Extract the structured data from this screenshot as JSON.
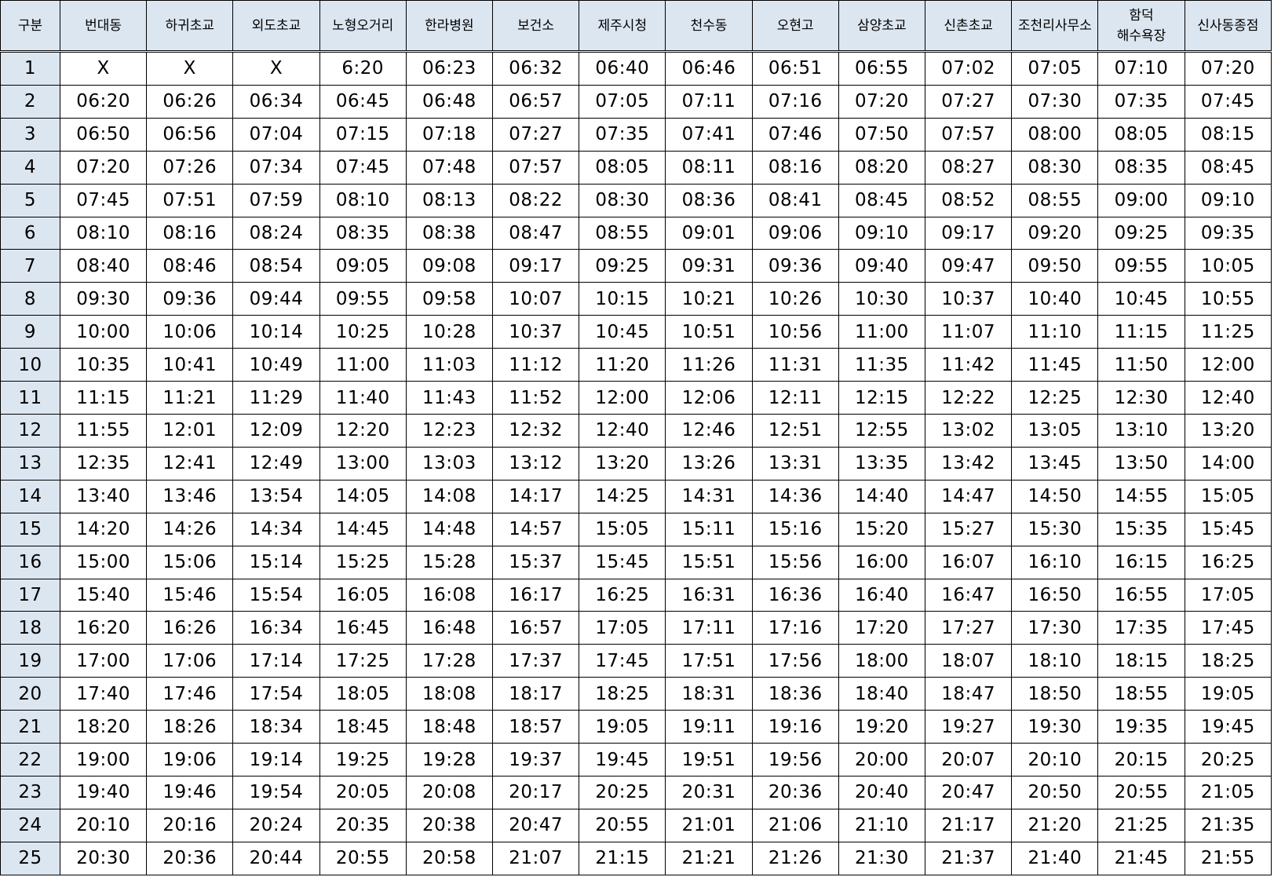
{
  "table": {
    "columns": [
      "구분",
      "번대동",
      "하귀초교",
      "외도초교",
      "노형오거리",
      "한라병원",
      "보건소",
      "제주시청",
      "천수동",
      "오현고",
      "삼양초교",
      "신촌초교",
      "조천리사무소",
      "함덕 해수욕장",
      "신사동종점"
    ],
    "rows": [
      [
        "1",
        "X",
        "X",
        "X",
        "6:20",
        "06:23",
        "06:32",
        "06:40",
        "06:46",
        "06:51",
        "06:55",
        "07:02",
        "07:05",
        "07:10",
        "07:20"
      ],
      [
        "2",
        "06:20",
        "06:26",
        "06:34",
        "06:45",
        "06:48",
        "06:57",
        "07:05",
        "07:11",
        "07:16",
        "07:20",
        "07:27",
        "07:30",
        "07:35",
        "07:45"
      ],
      [
        "3",
        "06:50",
        "06:56",
        "07:04",
        "07:15",
        "07:18",
        "07:27",
        "07:35",
        "07:41",
        "07:46",
        "07:50",
        "07:57",
        "08:00",
        "08:05",
        "08:15"
      ],
      [
        "4",
        "07:20",
        "07:26",
        "07:34",
        "07:45",
        "07:48",
        "07:57",
        "08:05",
        "08:11",
        "08:16",
        "08:20",
        "08:27",
        "08:30",
        "08:35",
        "08:45"
      ],
      [
        "5",
        "07:45",
        "07:51",
        "07:59",
        "08:10",
        "08:13",
        "08:22",
        "08:30",
        "08:36",
        "08:41",
        "08:45",
        "08:52",
        "08:55",
        "09:00",
        "09:10"
      ],
      [
        "6",
        "08:10",
        "08:16",
        "08:24",
        "08:35",
        "08:38",
        "08:47",
        "08:55",
        "09:01",
        "09:06",
        "09:10",
        "09:17",
        "09:20",
        "09:25",
        "09:35"
      ],
      [
        "7",
        "08:40",
        "08:46",
        "08:54",
        "09:05",
        "09:08",
        "09:17",
        "09:25",
        "09:31",
        "09:36",
        "09:40",
        "09:47",
        "09:50",
        "09:55",
        "10:05"
      ],
      [
        "8",
        "09:30",
        "09:36",
        "09:44",
        "09:55",
        "09:58",
        "10:07",
        "10:15",
        "10:21",
        "10:26",
        "10:30",
        "10:37",
        "10:40",
        "10:45",
        "10:55"
      ],
      [
        "9",
        "10:00",
        "10:06",
        "10:14",
        "10:25",
        "10:28",
        "10:37",
        "10:45",
        "10:51",
        "10:56",
        "11:00",
        "11:07",
        "11:10",
        "11:15",
        "11:25"
      ],
      [
        "10",
        "10:35",
        "10:41",
        "10:49",
        "11:00",
        "11:03",
        "11:12",
        "11:20",
        "11:26",
        "11:31",
        "11:35",
        "11:42",
        "11:45",
        "11:50",
        "12:00"
      ],
      [
        "11",
        "11:15",
        "11:21",
        "11:29",
        "11:40",
        "11:43",
        "11:52",
        "12:00",
        "12:06",
        "12:11",
        "12:15",
        "12:22",
        "12:25",
        "12:30",
        "12:40"
      ],
      [
        "12",
        "11:55",
        "12:01",
        "12:09",
        "12:20",
        "12:23",
        "12:32",
        "12:40",
        "12:46",
        "12:51",
        "12:55",
        "13:02",
        "13:05",
        "13:10",
        "13:20"
      ],
      [
        "13",
        "12:35",
        "12:41",
        "12:49",
        "13:00",
        "13:03",
        "13:12",
        "13:20",
        "13:26",
        "13:31",
        "13:35",
        "13:42",
        "13:45",
        "13:50",
        "14:00"
      ],
      [
        "14",
        "13:40",
        "13:46",
        "13:54",
        "14:05",
        "14:08",
        "14:17",
        "14:25",
        "14:31",
        "14:36",
        "14:40",
        "14:47",
        "14:50",
        "14:55",
        "15:05"
      ],
      [
        "15",
        "14:20",
        "14:26",
        "14:34",
        "14:45",
        "14:48",
        "14:57",
        "15:05",
        "15:11",
        "15:16",
        "15:20",
        "15:27",
        "15:30",
        "15:35",
        "15:45"
      ],
      [
        "16",
        "15:00",
        "15:06",
        "15:14",
        "15:25",
        "15:28",
        "15:37",
        "15:45",
        "15:51",
        "15:56",
        "16:00",
        "16:07",
        "16:10",
        "16:15",
        "16:25"
      ],
      [
        "17",
        "15:40",
        "15:46",
        "15:54",
        "16:05",
        "16:08",
        "16:17",
        "16:25",
        "16:31",
        "16:36",
        "16:40",
        "16:47",
        "16:50",
        "16:55",
        "17:05"
      ],
      [
        "18",
        "16:20",
        "16:26",
        "16:34",
        "16:45",
        "16:48",
        "16:57",
        "17:05",
        "17:11",
        "17:16",
        "17:20",
        "17:27",
        "17:30",
        "17:35",
        "17:45"
      ],
      [
        "19",
        "17:00",
        "17:06",
        "17:14",
        "17:25",
        "17:28",
        "17:37",
        "17:45",
        "17:51",
        "17:56",
        "18:00",
        "18:07",
        "18:10",
        "18:15",
        "18:25"
      ],
      [
        "20",
        "17:40",
        "17:46",
        "17:54",
        "18:05",
        "18:08",
        "18:17",
        "18:25",
        "18:31",
        "18:36",
        "18:40",
        "18:47",
        "18:50",
        "18:55",
        "19:05"
      ],
      [
        "21",
        "18:20",
        "18:26",
        "18:34",
        "18:45",
        "18:48",
        "18:57",
        "19:05",
        "19:11",
        "19:16",
        "19:20",
        "19:27",
        "19:30",
        "19:35",
        "19:45"
      ],
      [
        "22",
        "19:00",
        "19:06",
        "19:14",
        "19:25",
        "19:28",
        "19:37",
        "19:45",
        "19:51",
        "19:56",
        "20:00",
        "20:07",
        "20:10",
        "20:15",
        "20:25"
      ],
      [
        "23",
        "19:40",
        "19:46",
        "19:54",
        "20:05",
        "20:08",
        "20:17",
        "20:25",
        "20:31",
        "20:36",
        "20:40",
        "20:47",
        "20:50",
        "20:55",
        "21:05"
      ],
      [
        "24",
        "20:10",
        "20:16",
        "20:24",
        "20:35",
        "20:38",
        "20:47",
        "20:55",
        "21:01",
        "21:06",
        "21:10",
        "21:17",
        "21:20",
        "21:25",
        "21:35"
      ],
      [
        "25",
        "20:30",
        "20:36",
        "20:44",
        "20:55",
        "20:58",
        "21:07",
        "21:15",
        "21:21",
        "21:26",
        "21:30",
        "21:37",
        "21:40",
        "21:45",
        "21:55"
      ]
    ]
  },
  "colors": {
    "header_background": "#dce6f1",
    "index_column_background": "#dce6f1",
    "grid_lines": "#000000",
    "text": "#000000"
  }
}
